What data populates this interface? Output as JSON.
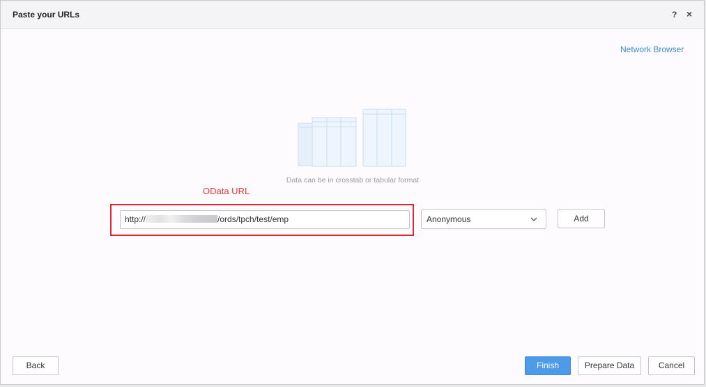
{
  "dialog": {
    "title": "Paste your URLs",
    "help_label": "?",
    "close_label": "×"
  },
  "network_browser_label": "Network Browser",
  "hint_text": "Data can be in crosstab or tabular format",
  "annotation": {
    "label": "OData URL",
    "color": "#e32630"
  },
  "url_input": {
    "prefix": "http://",
    "suffix": "/ords/tpch/test/emp"
  },
  "auth_select": {
    "selected": "Anonymous"
  },
  "buttons": {
    "add": "Add",
    "back": "Back",
    "finish": "Finish",
    "prepare_data": "Prepare Data",
    "cancel": "Cancel"
  },
  "colors": {
    "accent": "#4d9be8",
    "link": "#3b8fc9"
  }
}
